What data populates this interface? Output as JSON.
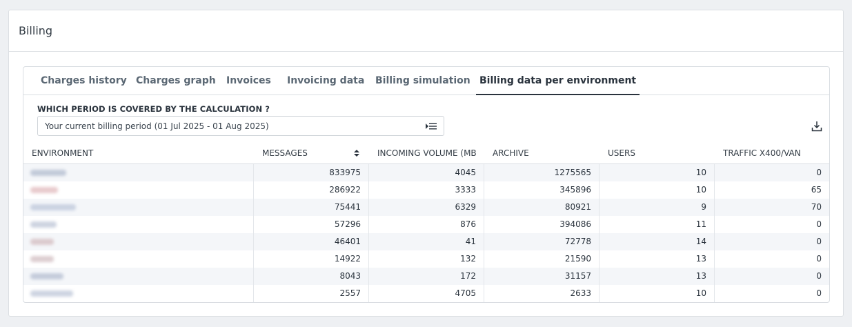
{
  "header": {
    "title": "Billing"
  },
  "tabs": [
    {
      "label": "Charges history",
      "active": false
    },
    {
      "label": "Charges graph",
      "active": false
    },
    {
      "label": "Invoices",
      "active": false
    },
    {
      "label": "Invoicing data",
      "active": false
    },
    {
      "label": "Billing simulation",
      "active": false
    },
    {
      "label": "Billing data per environment",
      "active": true
    }
  ],
  "period": {
    "label": "WHICH PERIOD IS COVERED BY THE CALCULATION ?",
    "value": "Your current billing period (01 Jul 2025 - 01 Aug 2025)"
  },
  "table": {
    "columns": [
      "ENVIRONMENT",
      "MESSAGES",
      "INCOMING VOLUME (MB)",
      "ARCHIVE",
      "USERS",
      "TRAFFIC X400/VAN"
    ],
    "sorted_column": "MESSAGES",
    "rows": [
      {
        "env_color": "#9aa7c0",
        "values": [
          "833975",
          "4045",
          "1275565",
          "10",
          "0"
        ]
      },
      {
        "env_color": "#d6a0a4",
        "values": [
          "286922",
          "3333",
          "345896",
          "10",
          "65"
        ]
      },
      {
        "env_color": "#a9b6cf",
        "values": [
          "75441",
          "6329",
          "80921",
          "9",
          "70"
        ]
      },
      {
        "env_color": "#a5b0c8",
        "values": [
          "57296",
          "876",
          "394086",
          "11",
          "0"
        ]
      },
      {
        "env_color": "#c8a7ab",
        "values": [
          "46401",
          "41",
          "72778",
          "14",
          "0"
        ]
      },
      {
        "env_color": "#c2a6ab",
        "values": [
          "14922",
          "132",
          "21590",
          "13",
          "0"
        ]
      },
      {
        "env_color": "#9eaac4",
        "values": [
          "8043",
          "172",
          "31157",
          "13",
          "0"
        ]
      },
      {
        "env_color": "#a6b2ca",
        "values": [
          "2557",
          "4705",
          "2633",
          "10",
          "0"
        ]
      }
    ]
  },
  "icons": {
    "select": "list-icon",
    "download": "download-icon",
    "sort": "sort-icon"
  }
}
